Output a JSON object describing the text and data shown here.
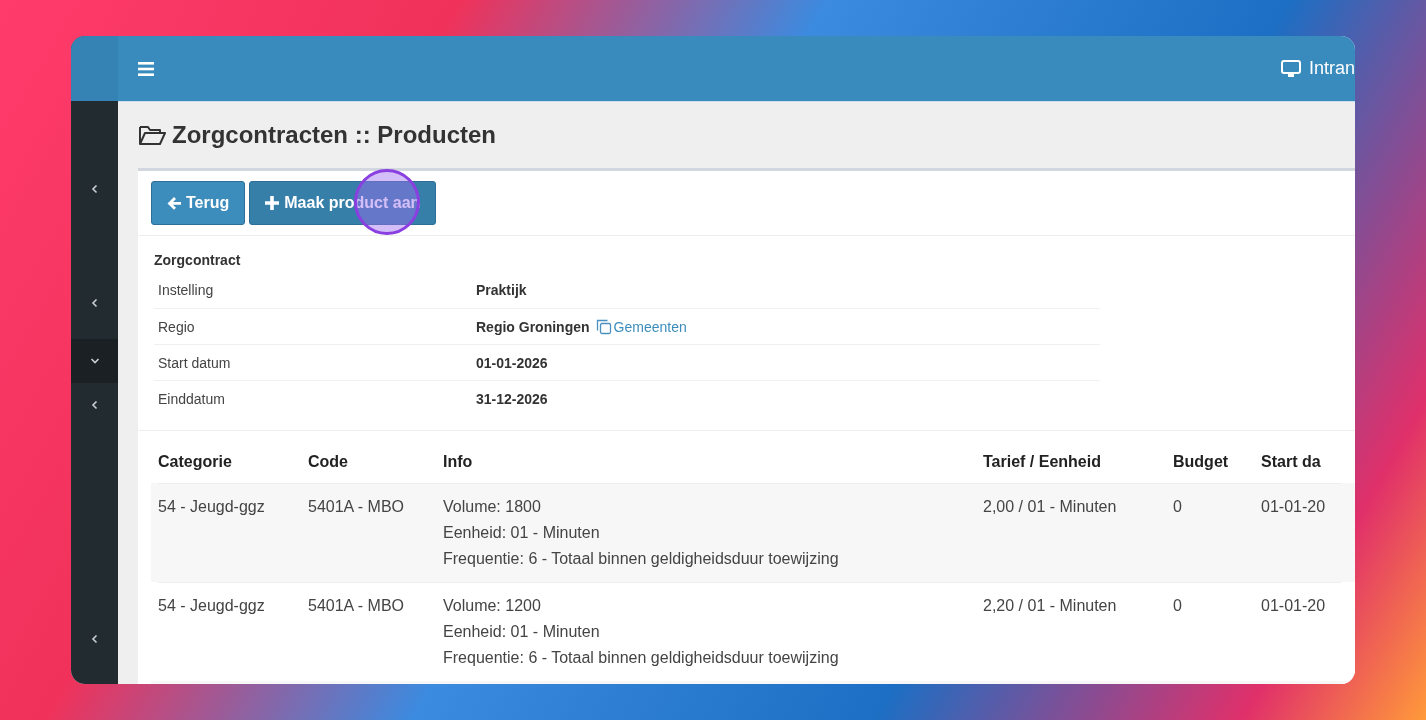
{
  "sidebar": {
    "items": [
      {
        "expanded": false
      },
      {
        "expanded": false
      },
      {
        "expanded": true
      },
      {
        "expanded": false
      },
      {
        "expanded": false
      }
    ]
  },
  "header": {
    "app_label": "Intran"
  },
  "page": {
    "title": "Zorgcontracten :: Producten"
  },
  "toolbar": {
    "buttons": [
      {
        "kind": "back",
        "label": "Terug"
      },
      {
        "kind": "create",
        "label": "Maak product aan"
      }
    ]
  },
  "click_highlight": true,
  "details": {
    "heading": "Zorgcontract",
    "rows": [
      {
        "label": "Instelling",
        "value": "Praktijk"
      },
      {
        "label": "Regio",
        "value": "Regio Groningen",
        "link": "Gemeenten"
      },
      {
        "label": "Start datum",
        "value": "01-01-2026"
      },
      {
        "label": "Einddatum",
        "value": "31-12-2026"
      }
    ]
  },
  "table": {
    "columns": [
      "Categorie",
      "Code",
      "Info",
      "Tarief / Eenheid",
      "Budget",
      "Start da"
    ],
    "rows": [
      {
        "cells": [
          "54 - Jeugd-ggz",
          "5401A - MBO",
          [
            "Volume: 1800",
            "Eenheid: 01 - Minuten",
            "Frequentie: 6 - Totaal binnen geldigheidsduur toewijzing"
          ],
          "2,00 / 01 - Minuten",
          "0",
          "01-01-20"
        ]
      },
      {
        "cells": [
          "54 - Jeugd-ggz",
          "5401A - MBO",
          [
            "Volume: 1200",
            "Eenheid: 01 - Minuten",
            "Frequentie: 6 - Totaal binnen geldigheidsduur toewijzing"
          ],
          "2,20 / 01 - Minuten",
          "0",
          "01-01-20"
        ]
      }
    ]
  }
}
